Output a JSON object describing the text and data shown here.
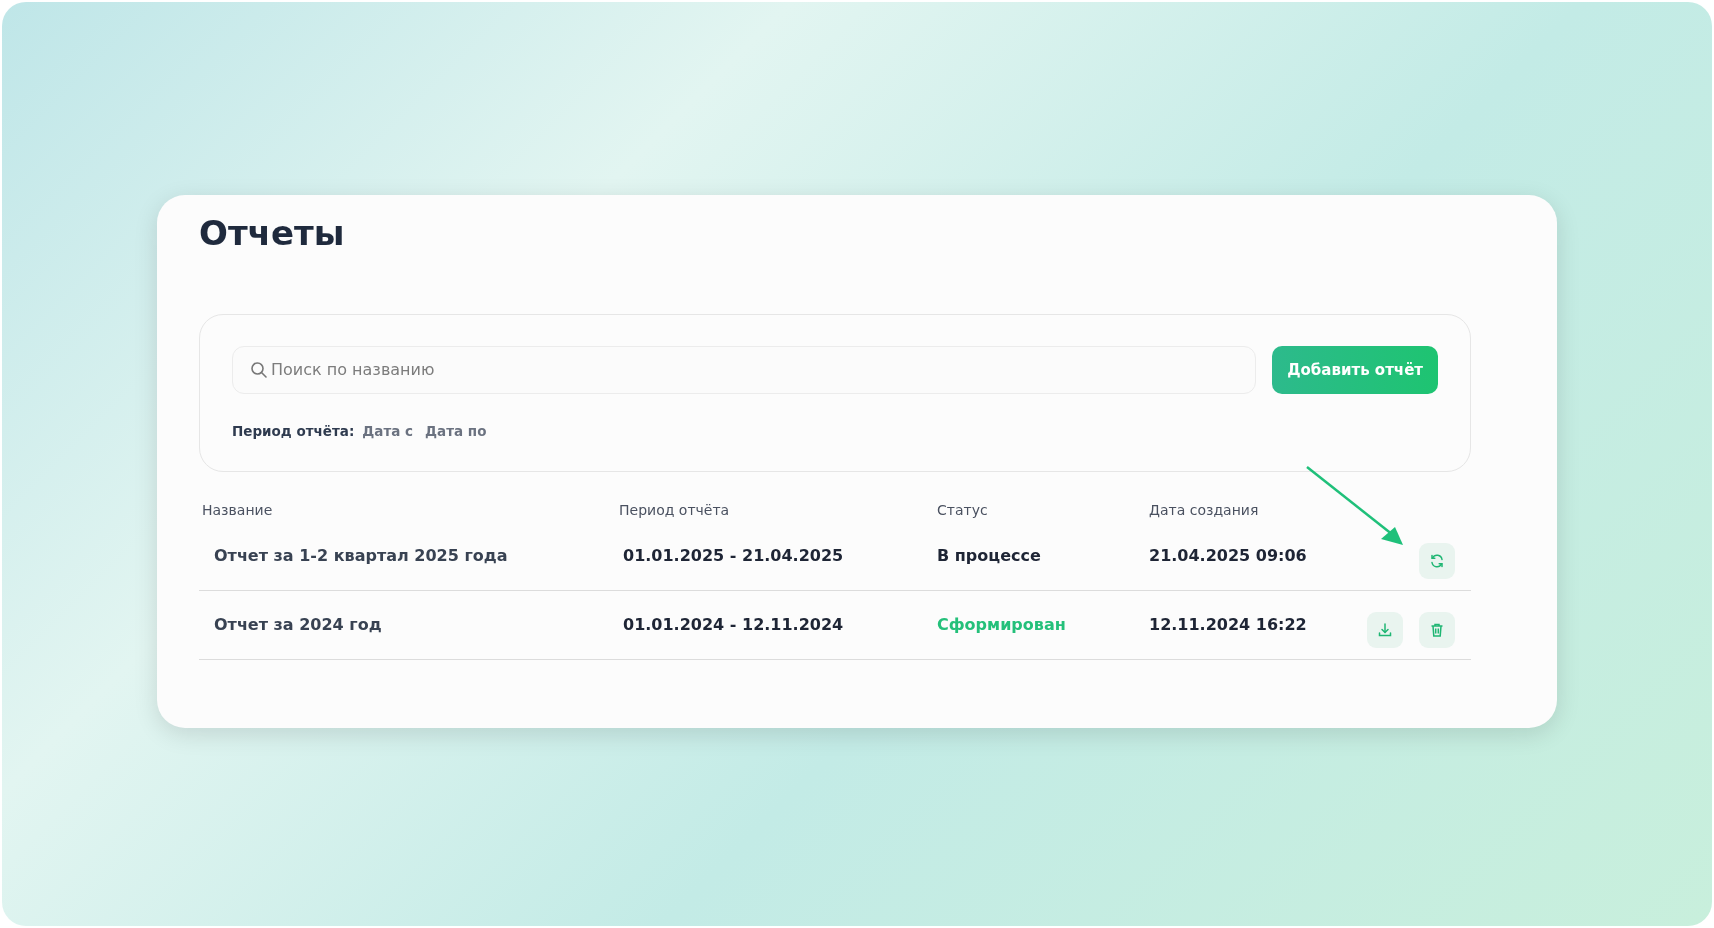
{
  "page": {
    "title": "Отчеты"
  },
  "search": {
    "placeholder": "Поиск по названию"
  },
  "add_button": {
    "label": "Добавить отчёт"
  },
  "period_filter": {
    "label": "Период отчёта:",
    "from": "Дата с",
    "to": "Дата по"
  },
  "table": {
    "columns": [
      "Название",
      "Период отчёта",
      "Статус",
      "Дата создания"
    ],
    "rows": [
      {
        "name": "Отчет за 1-2 квартал 2025 года",
        "period": "01.01.2025 - 21.04.2025",
        "status": {
          "label": "В процессе",
          "kind": "in_progress"
        },
        "created": "21.04.2025 09:06",
        "actions": [
          {
            "kind": "refresh"
          }
        ]
      },
      {
        "name": "Отчет за 2024 год",
        "period": "01.01.2024 - 12.11.2024",
        "status": {
          "label": "Сформирован",
          "kind": "done"
        },
        "created": "12.11.2024 16:22",
        "actions": [
          {
            "kind": "download"
          },
          {
            "kind": "delete"
          }
        ]
      }
    ]
  }
}
